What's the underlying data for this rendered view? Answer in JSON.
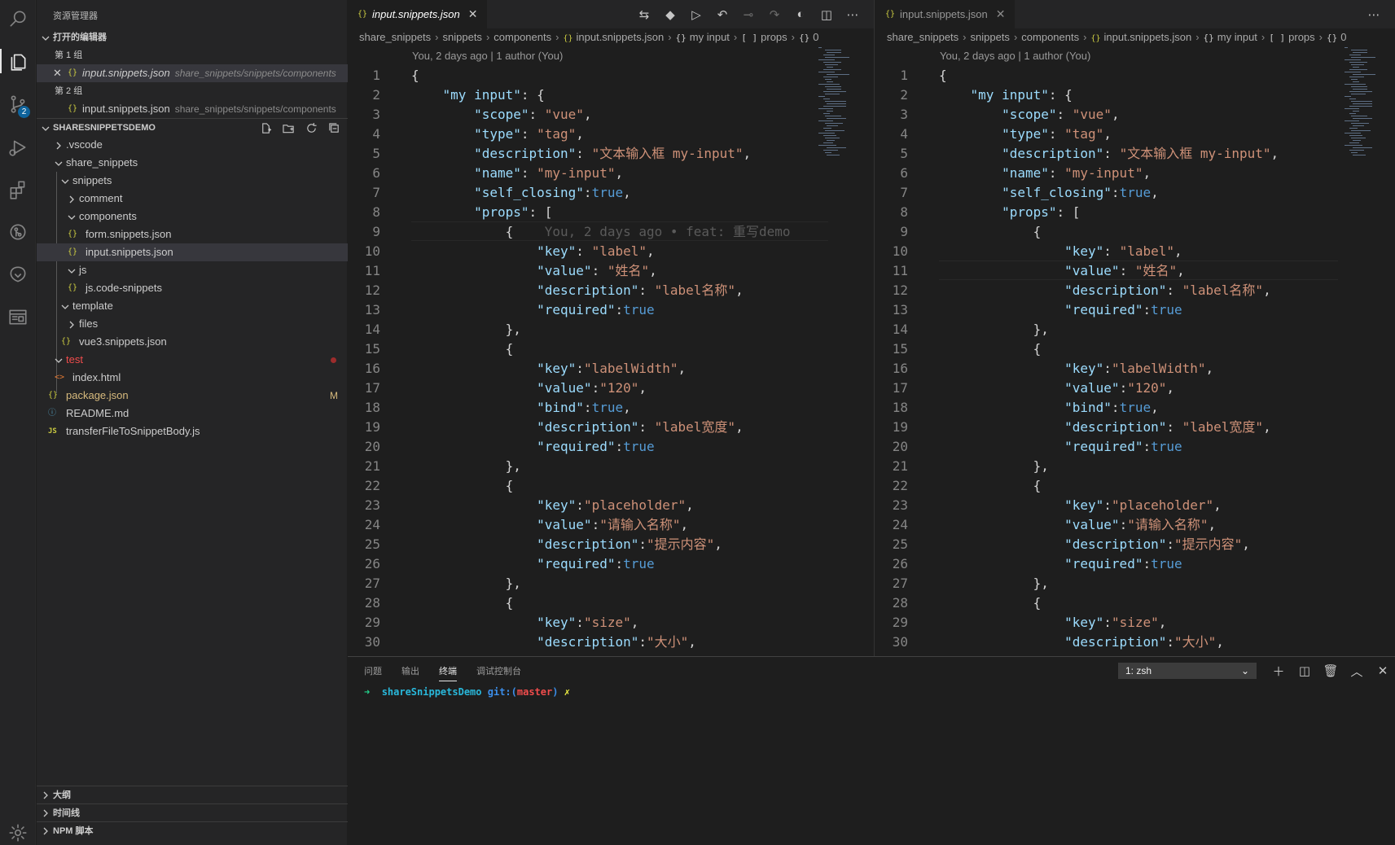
{
  "sidebar": {
    "title": "资源管理器",
    "open_editors": {
      "header": "打开的编辑器",
      "group1": "第 1 组",
      "group2": "第 2 组",
      "item1_name": "input.snippets.json",
      "item1_path": "share_snippets/snippets/components",
      "item2_name": "input.snippets.json",
      "item2_path": "share_snippets/snippets/components"
    },
    "workspace": {
      "header": "SHARESNIPPETSDEMO",
      "tree": [
        {
          "label": ".vscode",
          "type": "folder",
          "open": false
        },
        {
          "label": "share_snippets",
          "type": "folder",
          "open": true
        },
        {
          "label": "snippets",
          "type": "folder",
          "open": true
        },
        {
          "label": "comment",
          "type": "folder",
          "open": false
        },
        {
          "label": "components",
          "type": "folder",
          "open": true
        },
        {
          "label": "form.snippets.json",
          "type": "json"
        },
        {
          "label": "input.snippets.json",
          "type": "json"
        },
        {
          "label": "js",
          "type": "folder",
          "open": true
        },
        {
          "label": "js.code-snippets",
          "type": "json"
        },
        {
          "label": "template",
          "type": "folder",
          "open": true
        },
        {
          "label": "files",
          "type": "folder",
          "open": false
        },
        {
          "label": "vue3.snippets.json",
          "type": "json"
        },
        {
          "label": "test",
          "type": "folder",
          "open": true
        },
        {
          "label": "index.html",
          "type": "html"
        },
        {
          "label": "package.json",
          "type": "json"
        },
        {
          "label": "README.md",
          "type": "info"
        },
        {
          "label": "transferFileToSnippetBody.js",
          "type": "js"
        }
      ],
      "package_decoration": "M"
    },
    "bottom_sections": [
      "大纲",
      "时间线",
      "NPM 脚本"
    ]
  },
  "activity": {
    "scm_badge": "2"
  },
  "editor_left": {
    "tab_label": "input.snippets.json",
    "breadcrumbs": [
      "share_snippets",
      "snippets",
      "components",
      "input.snippets.json",
      "my input",
      "props",
      "0"
    ],
    "codelens": "You, 2 days ago | 1 author (You)",
    "blame": "You, 2 days ago • feat: 重写demo"
  },
  "editor_right": {
    "tab_label": "input.snippets.json",
    "breadcrumbs": [
      "share_snippets",
      "snippets",
      "components",
      "input.snippets.json",
      "my input",
      "props",
      "0"
    ],
    "codelens": "You, 2 days ago | 1 author (You)"
  },
  "code_lines": [
    [
      [
        "p",
        "{"
      ]
    ],
    [
      [
        "p",
        "    "
      ],
      [
        "k",
        "\"my input\""
      ],
      [
        "p",
        ": {"
      ]
    ],
    [
      [
        "p",
        "        "
      ],
      [
        "k",
        "\"scope\""
      ],
      [
        "p",
        ": "
      ],
      [
        "s",
        "\"vue\""
      ],
      [
        "p",
        ","
      ]
    ],
    [
      [
        "p",
        "        "
      ],
      [
        "k",
        "\"type\""
      ],
      [
        "p",
        ": "
      ],
      [
        "s",
        "\"tag\""
      ],
      [
        "p",
        ","
      ]
    ],
    [
      [
        "p",
        "        "
      ],
      [
        "k",
        "\"description\""
      ],
      [
        "p",
        ": "
      ],
      [
        "s",
        "\"文本输入框 my-input\""
      ],
      [
        "p",
        ","
      ]
    ],
    [
      [
        "p",
        "        "
      ],
      [
        "k",
        "\"name\""
      ],
      [
        "p",
        ": "
      ],
      [
        "s",
        "\"my-input\""
      ],
      [
        "p",
        ","
      ]
    ],
    [
      [
        "p",
        "        "
      ],
      [
        "k",
        "\"self_closing\""
      ],
      [
        "p",
        ":"
      ],
      [
        "b",
        "true"
      ],
      [
        "p",
        ","
      ]
    ],
    [
      [
        "p",
        "        "
      ],
      [
        "k",
        "\"props\""
      ],
      [
        "p",
        ": ["
      ]
    ],
    [
      [
        "p",
        "            {"
      ]
    ],
    [
      [
        "p",
        "                "
      ],
      [
        "k",
        "\"key\""
      ],
      [
        "p",
        ": "
      ],
      [
        "s",
        "\"label\""
      ],
      [
        "p",
        ","
      ]
    ],
    [
      [
        "p",
        "                "
      ],
      [
        "k",
        "\"value\""
      ],
      [
        "p",
        ": "
      ],
      [
        "s",
        "\"姓名\""
      ],
      [
        "p",
        ","
      ]
    ],
    [
      [
        "p",
        "                "
      ],
      [
        "k",
        "\"description\""
      ],
      [
        "p",
        ": "
      ],
      [
        "s",
        "\"label名称\""
      ],
      [
        "p",
        ","
      ]
    ],
    [
      [
        "p",
        "                "
      ],
      [
        "k",
        "\"required\""
      ],
      [
        "p",
        ":"
      ],
      [
        "b",
        "true"
      ]
    ],
    [
      [
        "p",
        "            },"
      ]
    ],
    [
      [
        "p",
        "            {"
      ]
    ],
    [
      [
        "p",
        "                "
      ],
      [
        "k",
        "\"key\""
      ],
      [
        "p",
        ":"
      ],
      [
        "s",
        "\"labelWidth\""
      ],
      [
        "p",
        ","
      ]
    ],
    [
      [
        "p",
        "                "
      ],
      [
        "k",
        "\"value\""
      ],
      [
        "p",
        ":"
      ],
      [
        "s",
        "\"120\""
      ],
      [
        "p",
        ","
      ]
    ],
    [
      [
        "p",
        "                "
      ],
      [
        "k",
        "\"bind\""
      ],
      [
        "p",
        ":"
      ],
      [
        "b",
        "true"
      ],
      [
        "p",
        ","
      ]
    ],
    [
      [
        "p",
        "                "
      ],
      [
        "k",
        "\"description\""
      ],
      [
        "p",
        ": "
      ],
      [
        "s",
        "\"label宽度\""
      ],
      [
        "p",
        ","
      ]
    ],
    [
      [
        "p",
        "                "
      ],
      [
        "k",
        "\"required\""
      ],
      [
        "p",
        ":"
      ],
      [
        "b",
        "true"
      ]
    ],
    [
      [
        "p",
        "            },"
      ]
    ],
    [
      [
        "p",
        "            {"
      ]
    ],
    [
      [
        "p",
        "                "
      ],
      [
        "k",
        "\"key\""
      ],
      [
        "p",
        ":"
      ],
      [
        "s",
        "\"placeholder\""
      ],
      [
        "p",
        ","
      ]
    ],
    [
      [
        "p",
        "                "
      ],
      [
        "k",
        "\"value\""
      ],
      [
        "p",
        ":"
      ],
      [
        "s",
        "\"请输入名称\""
      ],
      [
        "p",
        ","
      ]
    ],
    [
      [
        "p",
        "                "
      ],
      [
        "k",
        "\"description\""
      ],
      [
        "p",
        ":"
      ],
      [
        "s",
        "\"提示内容\""
      ],
      [
        "p",
        ","
      ]
    ],
    [
      [
        "p",
        "                "
      ],
      [
        "k",
        "\"required\""
      ],
      [
        "p",
        ":"
      ],
      [
        "b",
        "true"
      ]
    ],
    [
      [
        "p",
        "            },"
      ]
    ],
    [
      [
        "p",
        "            {"
      ]
    ],
    [
      [
        "p",
        "                "
      ],
      [
        "k",
        "\"key\""
      ],
      [
        "p",
        ":"
      ],
      [
        "s",
        "\"size\""
      ],
      [
        "p",
        ","
      ]
    ],
    [
      [
        "p",
        "                "
      ],
      [
        "k",
        "\"description\""
      ],
      [
        "p",
        ":"
      ],
      [
        "s",
        "\"大小\""
      ],
      [
        "p",
        ","
      ]
    ]
  ],
  "panel": {
    "tabs": [
      "问题",
      "输出",
      "终端",
      "调试控制台"
    ],
    "active_tab": "终端",
    "terminal_select": "1: zsh",
    "prompt_arrow": "➜",
    "prompt_dir": "shareSnippetsDemo",
    "prompt_git": "git:(",
    "prompt_branch": "master",
    "prompt_git_close": ")",
    "prompt_x": "✗"
  },
  "colors": {
    "key": "#9cdcfe",
    "string": "#ce9178",
    "boolean": "#569cd6",
    "modified": "#d7ba7d",
    "error": "#f14c4c"
  }
}
